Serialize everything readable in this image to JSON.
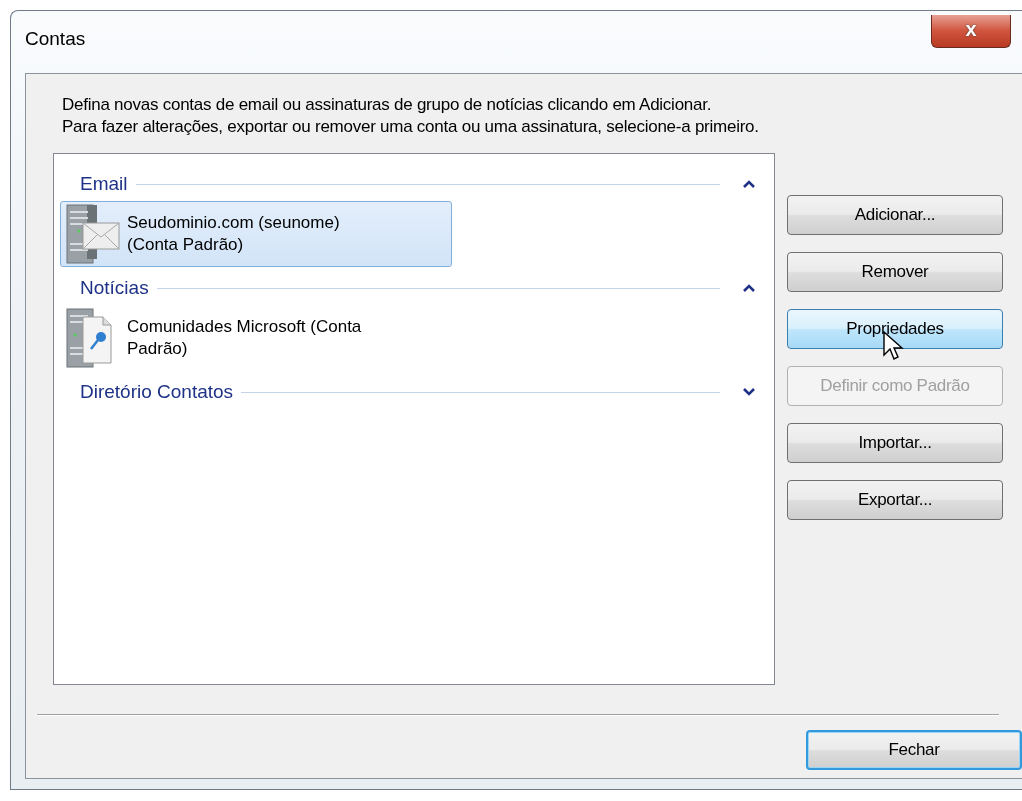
{
  "window": {
    "title": "Contas",
    "close_label": "x"
  },
  "description": [
    "Defina novas contas de email ou assinaturas de grupo de notícias clicando em Adicionar.",
    "Para fazer alterações, exportar ou remover uma conta ou uma assinatura, selecione-a primeiro."
  ],
  "groups": [
    {
      "title": "Email",
      "expanded": true,
      "accounts": [
        {
          "kind": "mail",
          "name": "Seudominio.com (seunome) (Conta Padrão)",
          "selected": true
        }
      ]
    },
    {
      "title": "Notícias",
      "expanded": true,
      "accounts": [
        {
          "kind": "news",
          "name": "Comunidades Microsoft (Conta Padrão)",
          "selected": false
        }
      ]
    },
    {
      "title": "Diretório Contatos",
      "expanded": false
    }
  ],
  "buttons": [
    {
      "label": "Adicionar...",
      "hovered": false,
      "disabled": false
    },
    {
      "label": "Remover",
      "hovered": false,
      "disabled": false
    },
    {
      "label": "Propriedades",
      "hovered": true,
      "disabled": false
    },
    {
      "label": "Definir como Padrão",
      "hovered": false,
      "disabled": true
    },
    {
      "label": "Importar...",
      "hovered": false,
      "disabled": false
    },
    {
      "label": "Exportar...",
      "hovered": false,
      "disabled": false
    }
  ],
  "close_button": {
    "label": "Fechar",
    "focused": true
  }
}
